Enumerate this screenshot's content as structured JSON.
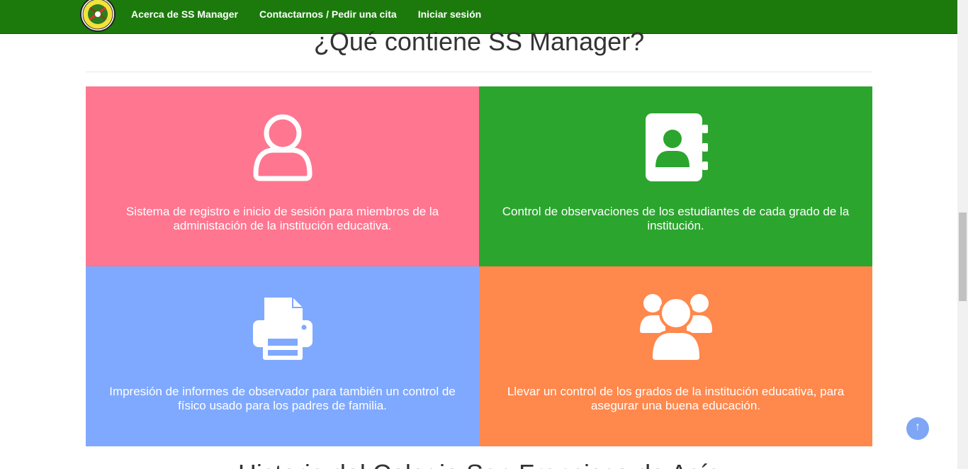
{
  "nav": {
    "links": [
      "Acerca de SS Manager",
      "Contactarnos / Pedir una cita",
      "Iniciar sesión"
    ]
  },
  "section": {
    "title": "¿Qué contiene SS Manager?"
  },
  "features": [
    {
      "icon": "user-outline-icon",
      "text": "Sistema de registro e inicio de sesión para miembros de la administación de la institución educativa.",
      "color": "#ff7690"
    },
    {
      "icon": "address-book-icon",
      "text": "Control de observaciones de los estudiantes de cada grado de la institución.",
      "color": "#2ba52e"
    },
    {
      "icon": "printer-icon",
      "text": "Impresión de informes de observador para también un control de físico usado para los padres de familia.",
      "color": "#7fa9ff"
    },
    {
      "icon": "users-group-icon",
      "text": "Llevar un control de los grados de la institución educativa, para asegurar una buena educación.",
      "color": "#ff884c"
    }
  ],
  "back_to_top": {
    "label": "↑",
    "color": "#7ea6f5"
  },
  "next_section": {
    "title": "Historia del Colegio San Francisco de Asís"
  },
  "theme": {
    "navbar": "#1b7a0b"
  }
}
